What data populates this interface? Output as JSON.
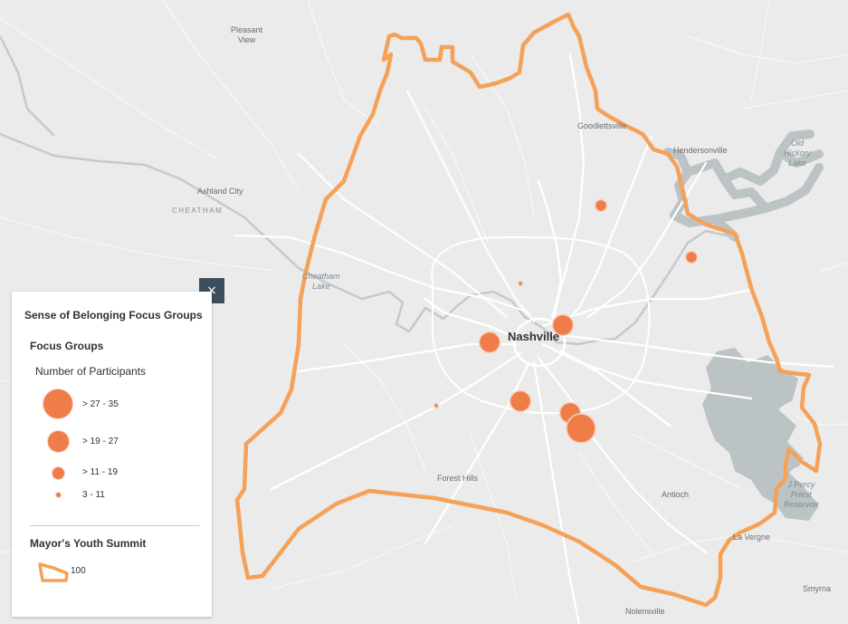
{
  "colors": {
    "background": "#ebebeb",
    "road": "#ffffff",
    "water": "#bcc3c4",
    "boundary": "#f5a158",
    "point": "#ef7d4a",
    "legend_close_bg": "#3d4e5c"
  },
  "map_labels": {
    "pleasant_view": "Pleasant\nView",
    "ashland_city": "Ashland City",
    "cheatham": "CHEATHAM",
    "cheatham_lake": "Cheatham\nLake",
    "goodlettsville": "Goodlettsville",
    "hendersonville": "Hendersonville",
    "old_hickory_lake": "Old\nHickory\nLake",
    "nashville": "Nashville",
    "forest_hills": "Forest Hills",
    "antioch": "Antioch",
    "percy_priest": "J Percy\nPriest\nReservoir",
    "la_vergne": "La Vergne",
    "smyrna": "Smyrna",
    "nolensville": "Nolensville"
  },
  "focus_group_points": [
    {
      "participants": 15,
      "size_class": "> 11 - 19"
    },
    {
      "participants": 14,
      "size_class": "> 11 - 19"
    },
    {
      "participants": 5,
      "size_class": "3 - 11"
    },
    {
      "participants": 24,
      "size_class": "> 19 - 27"
    },
    {
      "participants": 24,
      "size_class": "> 19 - 27"
    },
    {
      "participants": 24,
      "size_class": "> 19 - 27"
    },
    {
      "participants": 5,
      "size_class": "3 - 11"
    },
    {
      "participants": 24,
      "size_class": "> 19 - 27"
    },
    {
      "participants": 33,
      "size_class": "> 27 - 35"
    }
  ],
  "legend": {
    "close_icon": "×",
    "title": "Sense of Belonging Focus Groups",
    "focus_groups": {
      "layer_title": "Focus Groups",
      "field": "Number of Participants",
      "classes": [
        {
          "label": "> 27 - 35"
        },
        {
          "label": "> 19 - 27"
        },
        {
          "label": "> 11 - 19"
        },
        {
          "label": "3 - 11"
        }
      ]
    },
    "youth_summit": {
      "layer_title": "Mayor's Youth Summit",
      "value_label": "100"
    }
  }
}
